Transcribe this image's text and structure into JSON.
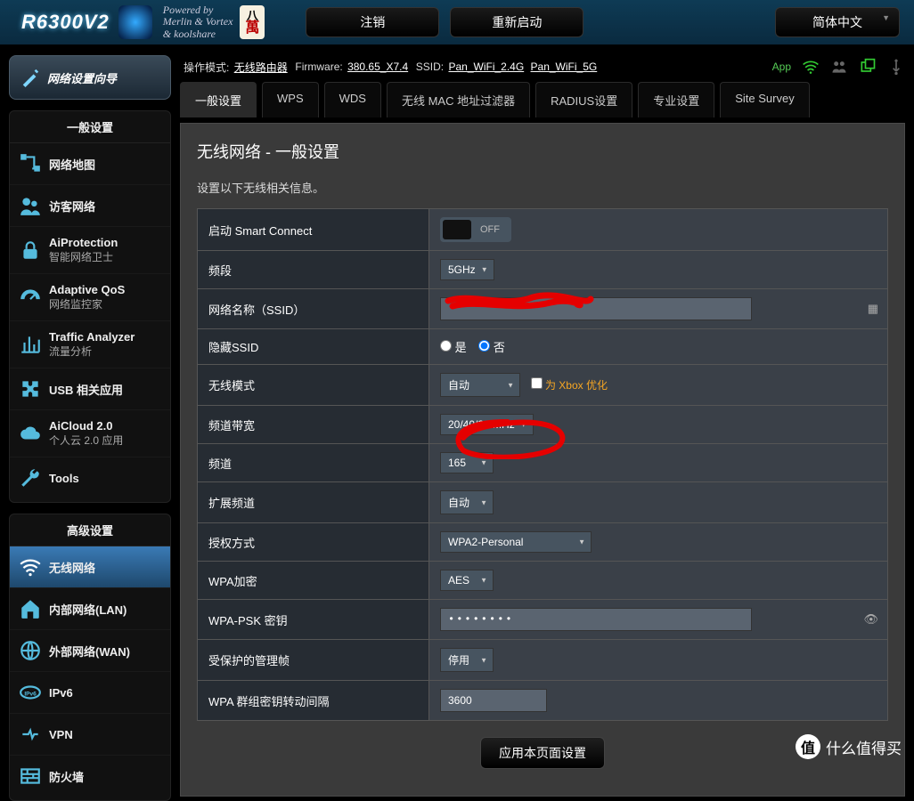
{
  "header": {
    "model": "R6300V2",
    "powered_l1": "Powered by",
    "powered_l2": "Merlin & Vortex",
    "powered_l3": "& koolshare",
    "logout_btn": "注销",
    "reboot_btn": "重新启动",
    "lang_btn": "简体中文"
  },
  "status": {
    "opmode_label": "操作模式:",
    "opmode_value": "无线路由器",
    "firmware_label": "Firmware:",
    "firmware_value": "380.65_X7.4",
    "ssid_label": "SSID:",
    "ssid_24": "Pan_WiFi_2.4G",
    "ssid_5": "Pan_WiFi_5G",
    "app_label": "App"
  },
  "sidebar": {
    "wizard": "网络设置向导",
    "sec1_title": "一般设置",
    "sec1": [
      {
        "label": "网络地图",
        "sub": ""
      },
      {
        "label": "访客网络",
        "sub": ""
      },
      {
        "label": "AiProtection",
        "sub": "智能网络卫士"
      },
      {
        "label": "Adaptive QoS",
        "sub": "网络监控家"
      },
      {
        "label": "Traffic Analyzer",
        "sub": "流量分析"
      },
      {
        "label": "USB 相关应用",
        "sub": ""
      },
      {
        "label": "AiCloud 2.0",
        "sub": "个人云 2.0 应用"
      },
      {
        "label": "Tools",
        "sub": ""
      }
    ],
    "sec2_title": "高级设置",
    "sec2": [
      {
        "label": "无线网络",
        "sub": ""
      },
      {
        "label": "内部网络(LAN)",
        "sub": ""
      },
      {
        "label": "外部网络(WAN)",
        "sub": ""
      },
      {
        "label": "IPv6",
        "sub": ""
      },
      {
        "label": "VPN",
        "sub": ""
      },
      {
        "label": "防火墙",
        "sub": ""
      }
    ]
  },
  "tabs": [
    "一般设置",
    "WPS",
    "WDS",
    "无线 MAC 地址过滤器",
    "RADIUS设置",
    "专业设置",
    "Site Survey"
  ],
  "active_tab": 0,
  "panel": {
    "title": "无线网络 - 一般设置",
    "desc": "设置以下无线相关信息。",
    "apply_btn": "应用本页面设置",
    "rows": {
      "smart_connect": {
        "label": "启动 Smart Connect",
        "value": "OFF"
      },
      "band": {
        "label": "频段",
        "value": "5GHz"
      },
      "ssid": {
        "label": "网络名称（SSID）",
        "value": ""
      },
      "hide_ssid": {
        "label": "隐藏SSID",
        "yes": "是",
        "no": "否"
      },
      "mode": {
        "label": "无线模式",
        "value": "自动",
        "xbox": "为 Xbox 优化"
      },
      "bw": {
        "label": "频道带宽",
        "value": "20/40/80 MHz"
      },
      "channel": {
        "label": "频道",
        "value": "165"
      },
      "ext": {
        "label": "扩展频道",
        "value": "自动"
      },
      "auth": {
        "label": "授权方式",
        "value": "WPA2-Personal"
      },
      "wpa_enc": {
        "label": "WPA加密",
        "value": "AES"
      },
      "psk": {
        "label": "WPA-PSK 密钥",
        "value": "••••••••"
      },
      "pmf": {
        "label": "受保护的管理帧",
        "value": "停用"
      },
      "rekey": {
        "label": "WPA 群组密钥转动间隔",
        "value": "3600"
      }
    }
  },
  "watermark": "什么值得买"
}
